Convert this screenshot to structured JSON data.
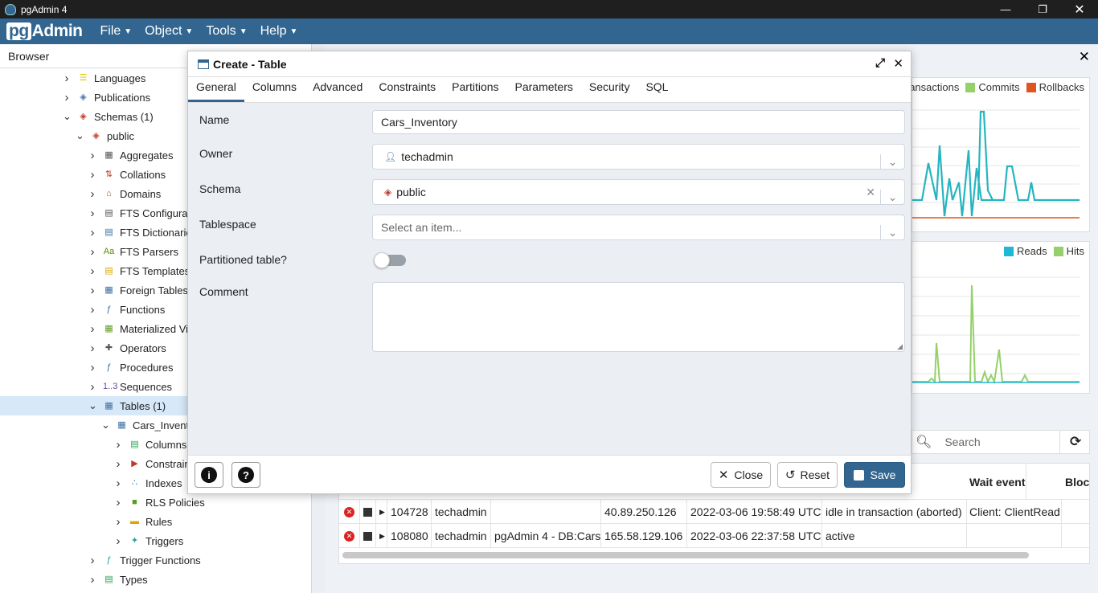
{
  "window": {
    "title": "pgAdmin 4"
  },
  "menu": {
    "logo_pg": "pg",
    "logo_rest": "Admin",
    "items": [
      "File",
      "Object",
      "Tools",
      "Help"
    ]
  },
  "browser": {
    "header": "Browser",
    "tree": [
      {
        "label": "Languages",
        "expanded": false
      },
      {
        "label": "Publications",
        "expanded": false
      },
      {
        "label": "Schemas (1)",
        "expanded": true
      },
      {
        "label": "public",
        "expanded": true
      },
      {
        "label": "Aggregates",
        "expanded": false
      },
      {
        "label": "Collations",
        "expanded": false
      },
      {
        "label": "Domains",
        "expanded": false
      },
      {
        "label": "FTS Configurati",
        "expanded": false
      },
      {
        "label": "FTS Dictionarie",
        "expanded": false
      },
      {
        "label": "FTS Parsers",
        "expanded": false
      },
      {
        "label": "FTS Templates",
        "expanded": false
      },
      {
        "label": "Foreign Tables",
        "expanded": false
      },
      {
        "label": "Functions",
        "expanded": false
      },
      {
        "label": "Materialized Vi",
        "expanded": false
      },
      {
        "label": "Operators",
        "expanded": false
      },
      {
        "label": "Procedures",
        "expanded": false
      },
      {
        "label": "Sequences",
        "expanded": false
      },
      {
        "label": "Tables (1)",
        "expanded": true
      },
      {
        "label": "Cars_Invento",
        "expanded": true
      },
      {
        "label": "Columns",
        "expanded": false
      },
      {
        "label": "Constrain",
        "expanded": false
      },
      {
        "label": "Indexes",
        "expanded": false
      },
      {
        "label": "RLS Policies",
        "expanded": false
      },
      {
        "label": "Rules",
        "expanded": false
      },
      {
        "label": "Triggers",
        "expanded": false
      },
      {
        "label": "Trigger Functions",
        "expanded": false
      },
      {
        "label": "Types",
        "expanded": false
      }
    ]
  },
  "dashboard": {
    "graph1_legend": [
      "ansactions",
      "Commits",
      "Rollbacks"
    ],
    "graph2_legend": [
      "Reads",
      "Hits"
    ],
    "colors": {
      "transactions": "#26b5bf",
      "commits": "#95d06a",
      "rollbacks": "#e0541f",
      "reads": "#1eb7d4",
      "hits": "#95d06a"
    },
    "search_placeholder": "Search",
    "columns": [
      "Wait event",
      "Bloc"
    ],
    "rows": [
      {
        "pid": "104728",
        "user": "techadmin",
        "app": "",
        "client": "40.89.250.126",
        "start": "2022-03-06 19:58:49 UTC",
        "state": "idle in transaction (aborted)",
        "wait": "Client: ClientRead"
      },
      {
        "pid": "108080",
        "user": "techadmin",
        "app": "pgAdmin 4 - DB:Cars",
        "client": "165.58.129.106",
        "start": "2022-03-06 22:37:58 UTC",
        "state": "active",
        "wait": ""
      }
    ]
  },
  "dialog": {
    "title": "Create - Table",
    "tabs": [
      "General",
      "Columns",
      "Advanced",
      "Constraints",
      "Partitions",
      "Parameters",
      "Security",
      "SQL"
    ],
    "fields": {
      "name_label": "Name",
      "name_value": "Cars_Inventory",
      "owner_label": "Owner",
      "owner_value": "techadmin",
      "schema_label": "Schema",
      "schema_value": "public",
      "tablespace_label": "Tablespace",
      "tablespace_placeholder": "Select an item...",
      "partitioned_label": "Partitioned table?",
      "comment_label": "Comment",
      "comment_value": ""
    },
    "buttons": {
      "close": "Close",
      "reset": "Reset",
      "save": "Save"
    }
  }
}
